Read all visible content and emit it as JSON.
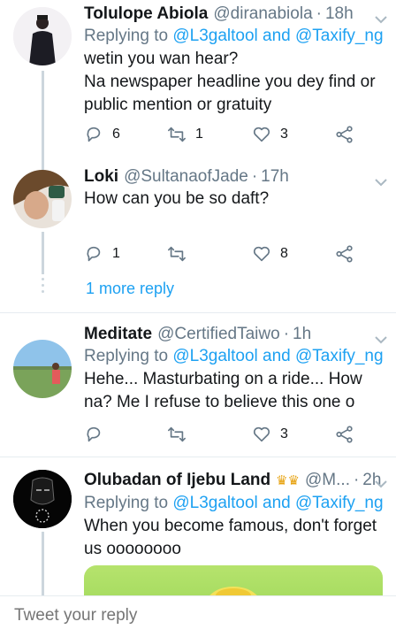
{
  "tweets": [
    {
      "name": "Tolulope Abiola",
      "handle": "@diranabiola",
      "time": "18h",
      "replying_prefix": "Replying to",
      "mentions": "@L3galtool and @Taxify_ng",
      "lines": [
        "wetin you wan hear?",
        "Na newspaper headline you dey find or",
        "public mention or gratuity"
      ],
      "replies": "6",
      "retweets": "1",
      "likes": "3"
    },
    {
      "name": "Loki",
      "handle": "@SultanaofJade",
      "time": "17h",
      "lines": [
        "How can you be so daft?"
      ],
      "replies": "1",
      "retweets": "",
      "likes": "8"
    },
    {
      "name": "Meditate",
      "handle": "@CertifiedTaiwo",
      "time": "1h",
      "replying_prefix": "Replying to",
      "mentions": "@L3galtool and @Taxify_ng",
      "lines": [
        "Hehe... Masturbating on a ride... How",
        "na? Me I refuse to believe this one o"
      ],
      "replies": "",
      "retweets": "",
      "likes": "3"
    },
    {
      "name": "Olubadan of Ijebu Land",
      "handle": "@M...",
      "time": "2h",
      "replying_prefix": "Replying to",
      "mentions": "@L3galtool and @Taxify_ng",
      "lines": [
        "When you become famous, don't forget",
        "us oooooooo"
      ]
    }
  ],
  "more_reply_label": "1 more reply",
  "reply_placeholder": "Tweet your reply",
  "dot_separator": "·",
  "icons": {
    "reply": "reply-icon",
    "retweet": "retweet-icon",
    "like": "heart-icon",
    "share": "share-icon",
    "chevron": "chevron-down-icon",
    "crown": "crown-emoji"
  },
  "colors": {
    "link": "#1da1f2",
    "secondary_text": "#657786",
    "divider": "#e6ecf0"
  }
}
